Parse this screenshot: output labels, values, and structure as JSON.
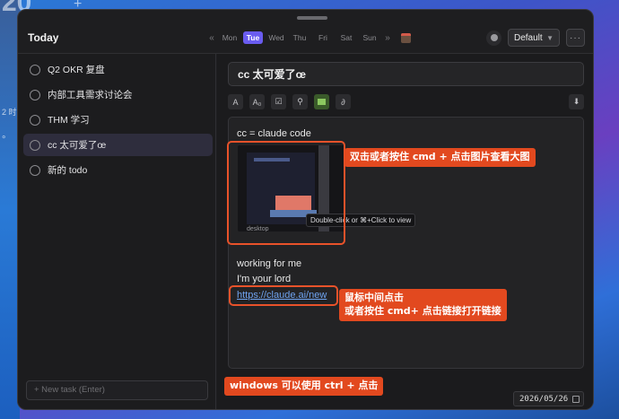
{
  "window": {
    "title": "Today"
  },
  "week": {
    "prev": "«",
    "next": "»",
    "days": [
      "Mon",
      "Tue",
      "Wed",
      "Thu",
      "Fri",
      "Sat",
      "Sun"
    ],
    "active_index": 1
  },
  "top_right": {
    "select_value": "Default",
    "more_label": "···"
  },
  "tasks": [
    {
      "label": "Q2 OKR 复盘"
    },
    {
      "label": "内部工具需求讨论会"
    },
    {
      "label": "THM 学习"
    },
    {
      "label": "cc 太可爱了œ"
    },
    {
      "label": "新的 todo"
    }
  ],
  "selected_task_index": 3,
  "new_task_placeholder": "+ New task (Enter)",
  "detail": {
    "title": "cc 太可爱了œ",
    "toolbar": {
      "text": "A",
      "font_size": "A₀",
      "checklist": "☑",
      "link": "🔗",
      "attach": "⎙",
      "download": "⬇"
    },
    "body": {
      "line1": "cc = claude code",
      "image_caption": "desktop",
      "image_tooltip": "Double-click or ⌘+Click to view",
      "line2": "working for me",
      "line3": "I'm your lord",
      "link": "https://claude.ai/new"
    },
    "due_date": "2026/05/26"
  },
  "annotations": {
    "image_hint": "双击或者按住 cmd + 点击图片查看大图",
    "link_hint_1": "鼠标中间点击",
    "link_hint_2": "或者按住 cmd+ 点击链接打开链接",
    "windows_hint": "windows 可以使用 ctrl + 点击"
  },
  "wallpaper": {
    "time_text": "2 时",
    "degree_text": "°"
  },
  "colors": {
    "accent": "#6a5cf0",
    "annotation": "#e2491f",
    "link": "#6fa3f0",
    "window_bg": "#1e1e20"
  }
}
